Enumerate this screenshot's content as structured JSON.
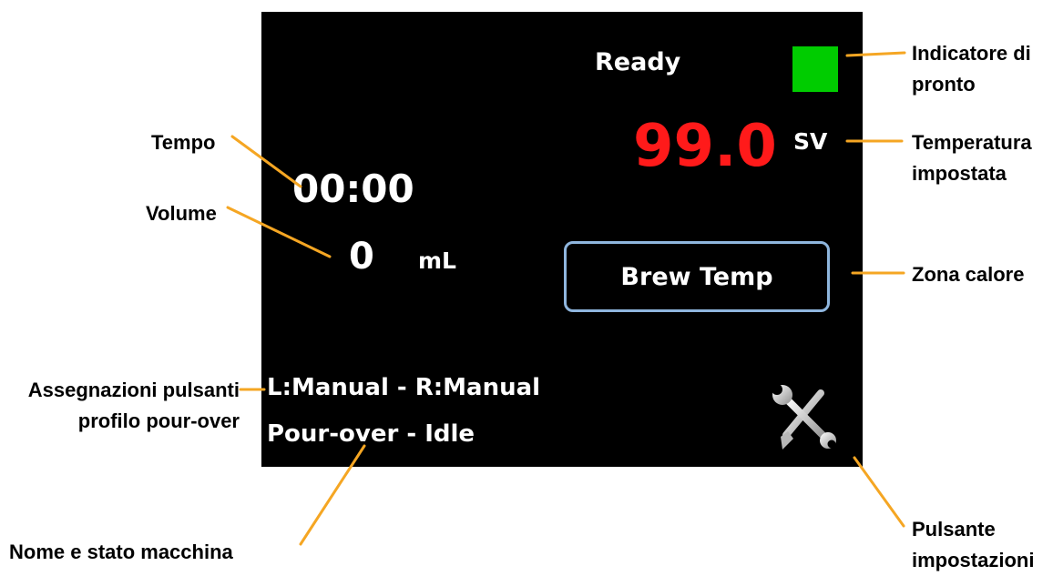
{
  "screen": {
    "status_text": "Ready",
    "set_temperature": "99.0",
    "set_temperature_unit": "SV",
    "timer": "00:00",
    "volume_value": "0",
    "volume_unit": "mL",
    "heat_zone_label": "Brew Temp",
    "button_assignments": "L:Manual - R:Manual",
    "machine_status": "Pour-over - Idle",
    "icons": {
      "ready_indicator": "green-square",
      "settings": "wrench-screwdriver-icon"
    },
    "colors": {
      "background": "#000000",
      "text": "#ffffff",
      "temperature": "#ff1a1a",
      "ready_indicator": "#00cc00",
      "button_border": "#8fb6de",
      "ring_inner": "#2f8f8c",
      "ring_outer": "#d9d9d9"
    }
  },
  "callouts": {
    "ready_indicator": {
      "line1": "Indicatore di",
      "line2": "pronto"
    },
    "set_temperature": {
      "line1": "Temperatura",
      "line2": "impostata"
    },
    "heat_zone": "Zona calore",
    "settings_button": {
      "line1": "Pulsante",
      "line2": "impostazioni"
    },
    "time": "Tempo",
    "volume": "Volume",
    "button_assignments": {
      "line1": "Assegnazioni pulsanti",
      "line2": "profilo pour-over"
    },
    "machine_name_status": "Nome e stato macchina",
    "leader_color": "#f5a623"
  }
}
